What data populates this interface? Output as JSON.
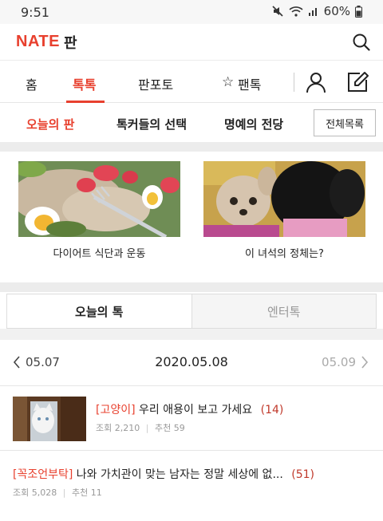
{
  "status_bar": {
    "time": "9:51",
    "battery": "60%"
  },
  "header": {
    "logo": "NATE",
    "logo_sub": "판"
  },
  "main_nav": {
    "tabs": [
      "홈",
      "톡톡",
      "판포토",
      "팬톡"
    ],
    "active": "톡톡"
  },
  "sub_nav": {
    "items": [
      "오늘의 판",
      "톡커들의 선택",
      "명예의 전당"
    ],
    "active": "오늘의 판",
    "all_button": "전체목록"
  },
  "featured": [
    {
      "caption": "다이어트 식단과 운동"
    },
    {
      "caption": "이 녀석의 정체는?"
    }
  ],
  "toggle": {
    "left": "오늘의 톡",
    "right": "엔터톡",
    "active": "오늘의 톡"
  },
  "date_bar": {
    "prev": "05.07",
    "current": "2020.05.08",
    "next": "05.09"
  },
  "posts": [
    {
      "category": "[고양이]",
      "title": "우리 애용이 보고 가세요",
      "comments": "(14)",
      "views_label": "조회",
      "views": "2,210",
      "likes_label": "추천",
      "likes": "59"
    },
    {
      "category": "[꼭조언부탁]",
      "title": "나와 가치관이 맞는 남자는 정말 세상에 없...",
      "comments": "(51)",
      "views_label": "조회",
      "views": "5,028",
      "likes_label": "추천",
      "likes": "11"
    }
  ],
  "colors": {
    "accent": "#e8402e",
    "muted": "#999999"
  }
}
